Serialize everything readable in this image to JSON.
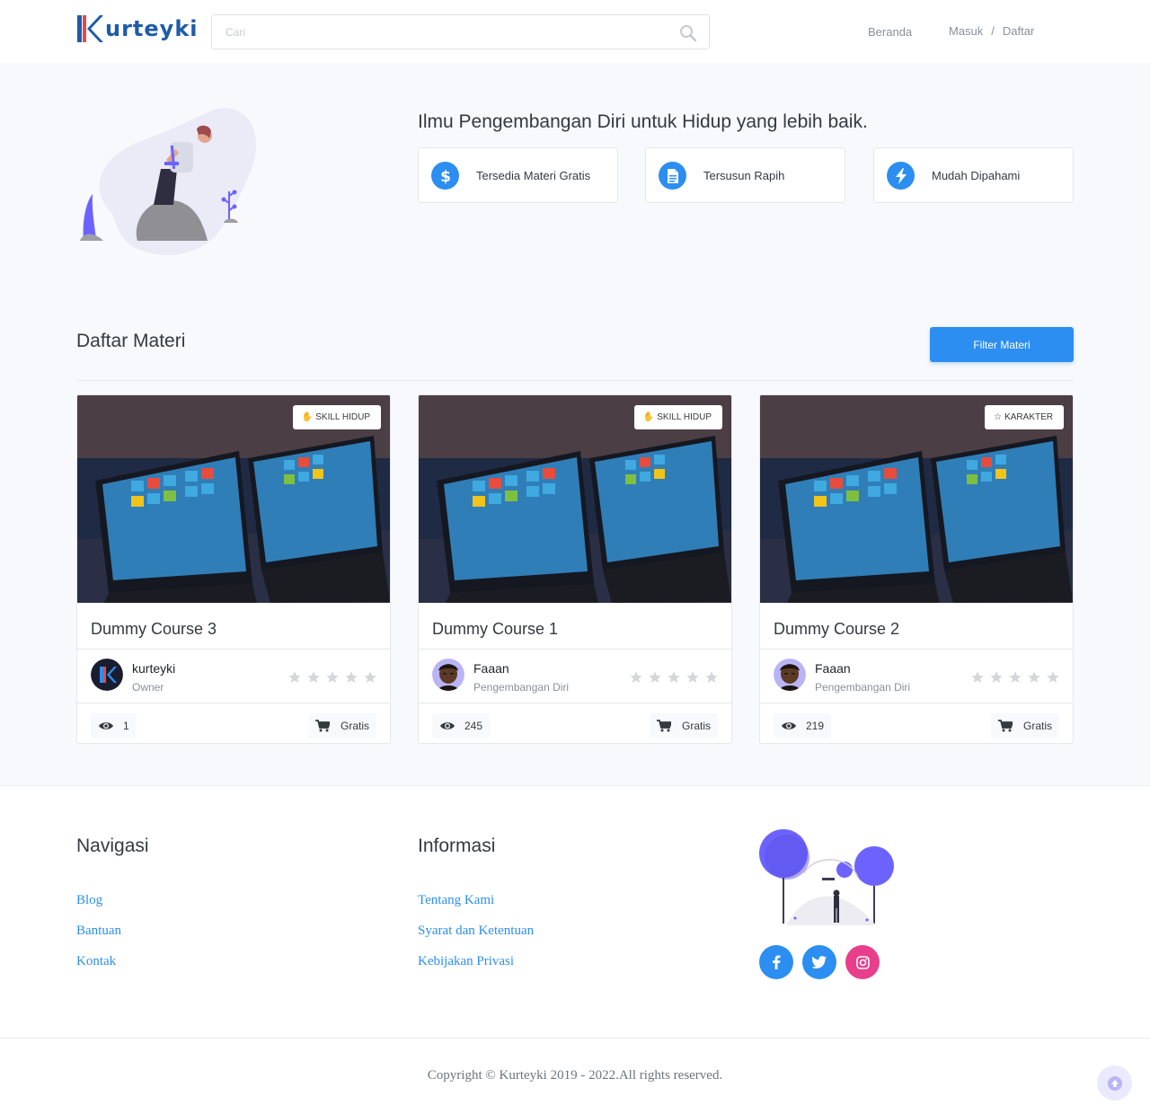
{
  "header": {
    "logo_text": "urteyki",
    "search_placeholder": "Cari",
    "nav_home": "Beranda",
    "nav_login": "Masuk",
    "nav_sep": "/",
    "nav_register": "Daftar"
  },
  "hero": {
    "title": "Ilmu Pengembangan Diri untuk Hidup yang lebih baik.",
    "features": [
      {
        "label": "Tersedia Materi Gratis",
        "icon": "dollar-icon"
      },
      {
        "label": "Tersusun Rapih",
        "icon": "document-icon"
      },
      {
        "label": "Mudah Dipahami",
        "icon": "bolt-icon"
      }
    ]
  },
  "courses_section": {
    "title": "Daftar Materi",
    "filter_label": "Filter Materi"
  },
  "courses": [
    {
      "title": "Dummy Course 3",
      "badge": "SKILL HIDUP",
      "badge_icon": "hand-icon",
      "author": "kurteyki",
      "role": "Owner",
      "views": "1",
      "price": "Gratis",
      "rating": 0
    },
    {
      "title": "Dummy Course 1",
      "badge": "SKILL HIDUP",
      "badge_icon": "hand-icon",
      "author": "Faaan",
      "role": "Pengembangan Diri",
      "views": "245",
      "price": "Gratis",
      "rating": 0
    },
    {
      "title": "Dummy Course 2",
      "badge": "KARAKTER",
      "badge_icon": "star-outline-icon",
      "author": "Faaan",
      "role": "Pengembangan Diri",
      "views": "219",
      "price": "Gratis",
      "rating": 0
    }
  ],
  "footer": {
    "nav_title": "Navigasi",
    "nav_links": [
      "Blog",
      "Bantuan",
      "Kontak"
    ],
    "info_title": "Informasi",
    "info_links": [
      "Tentang Kami",
      "Syarat dan Ketentuan",
      "Kebijakan Privasi"
    ],
    "social": [
      {
        "name": "facebook-icon",
        "color": "#2c8ef0"
      },
      {
        "name": "twitter-icon",
        "color": "#2c8ef0"
      },
      {
        "name": "instagram-icon",
        "color": "#e83e8c"
      }
    ],
    "copyright": "Copyright © Kurteyki 2019 - 2022.All rights reserved."
  },
  "colors": {
    "primary": "#2c8ef0",
    "accent_purple": "#6c63ff",
    "text": "#343a40",
    "muted": "#8a9097",
    "hero_bg": "#f8f9fc"
  }
}
